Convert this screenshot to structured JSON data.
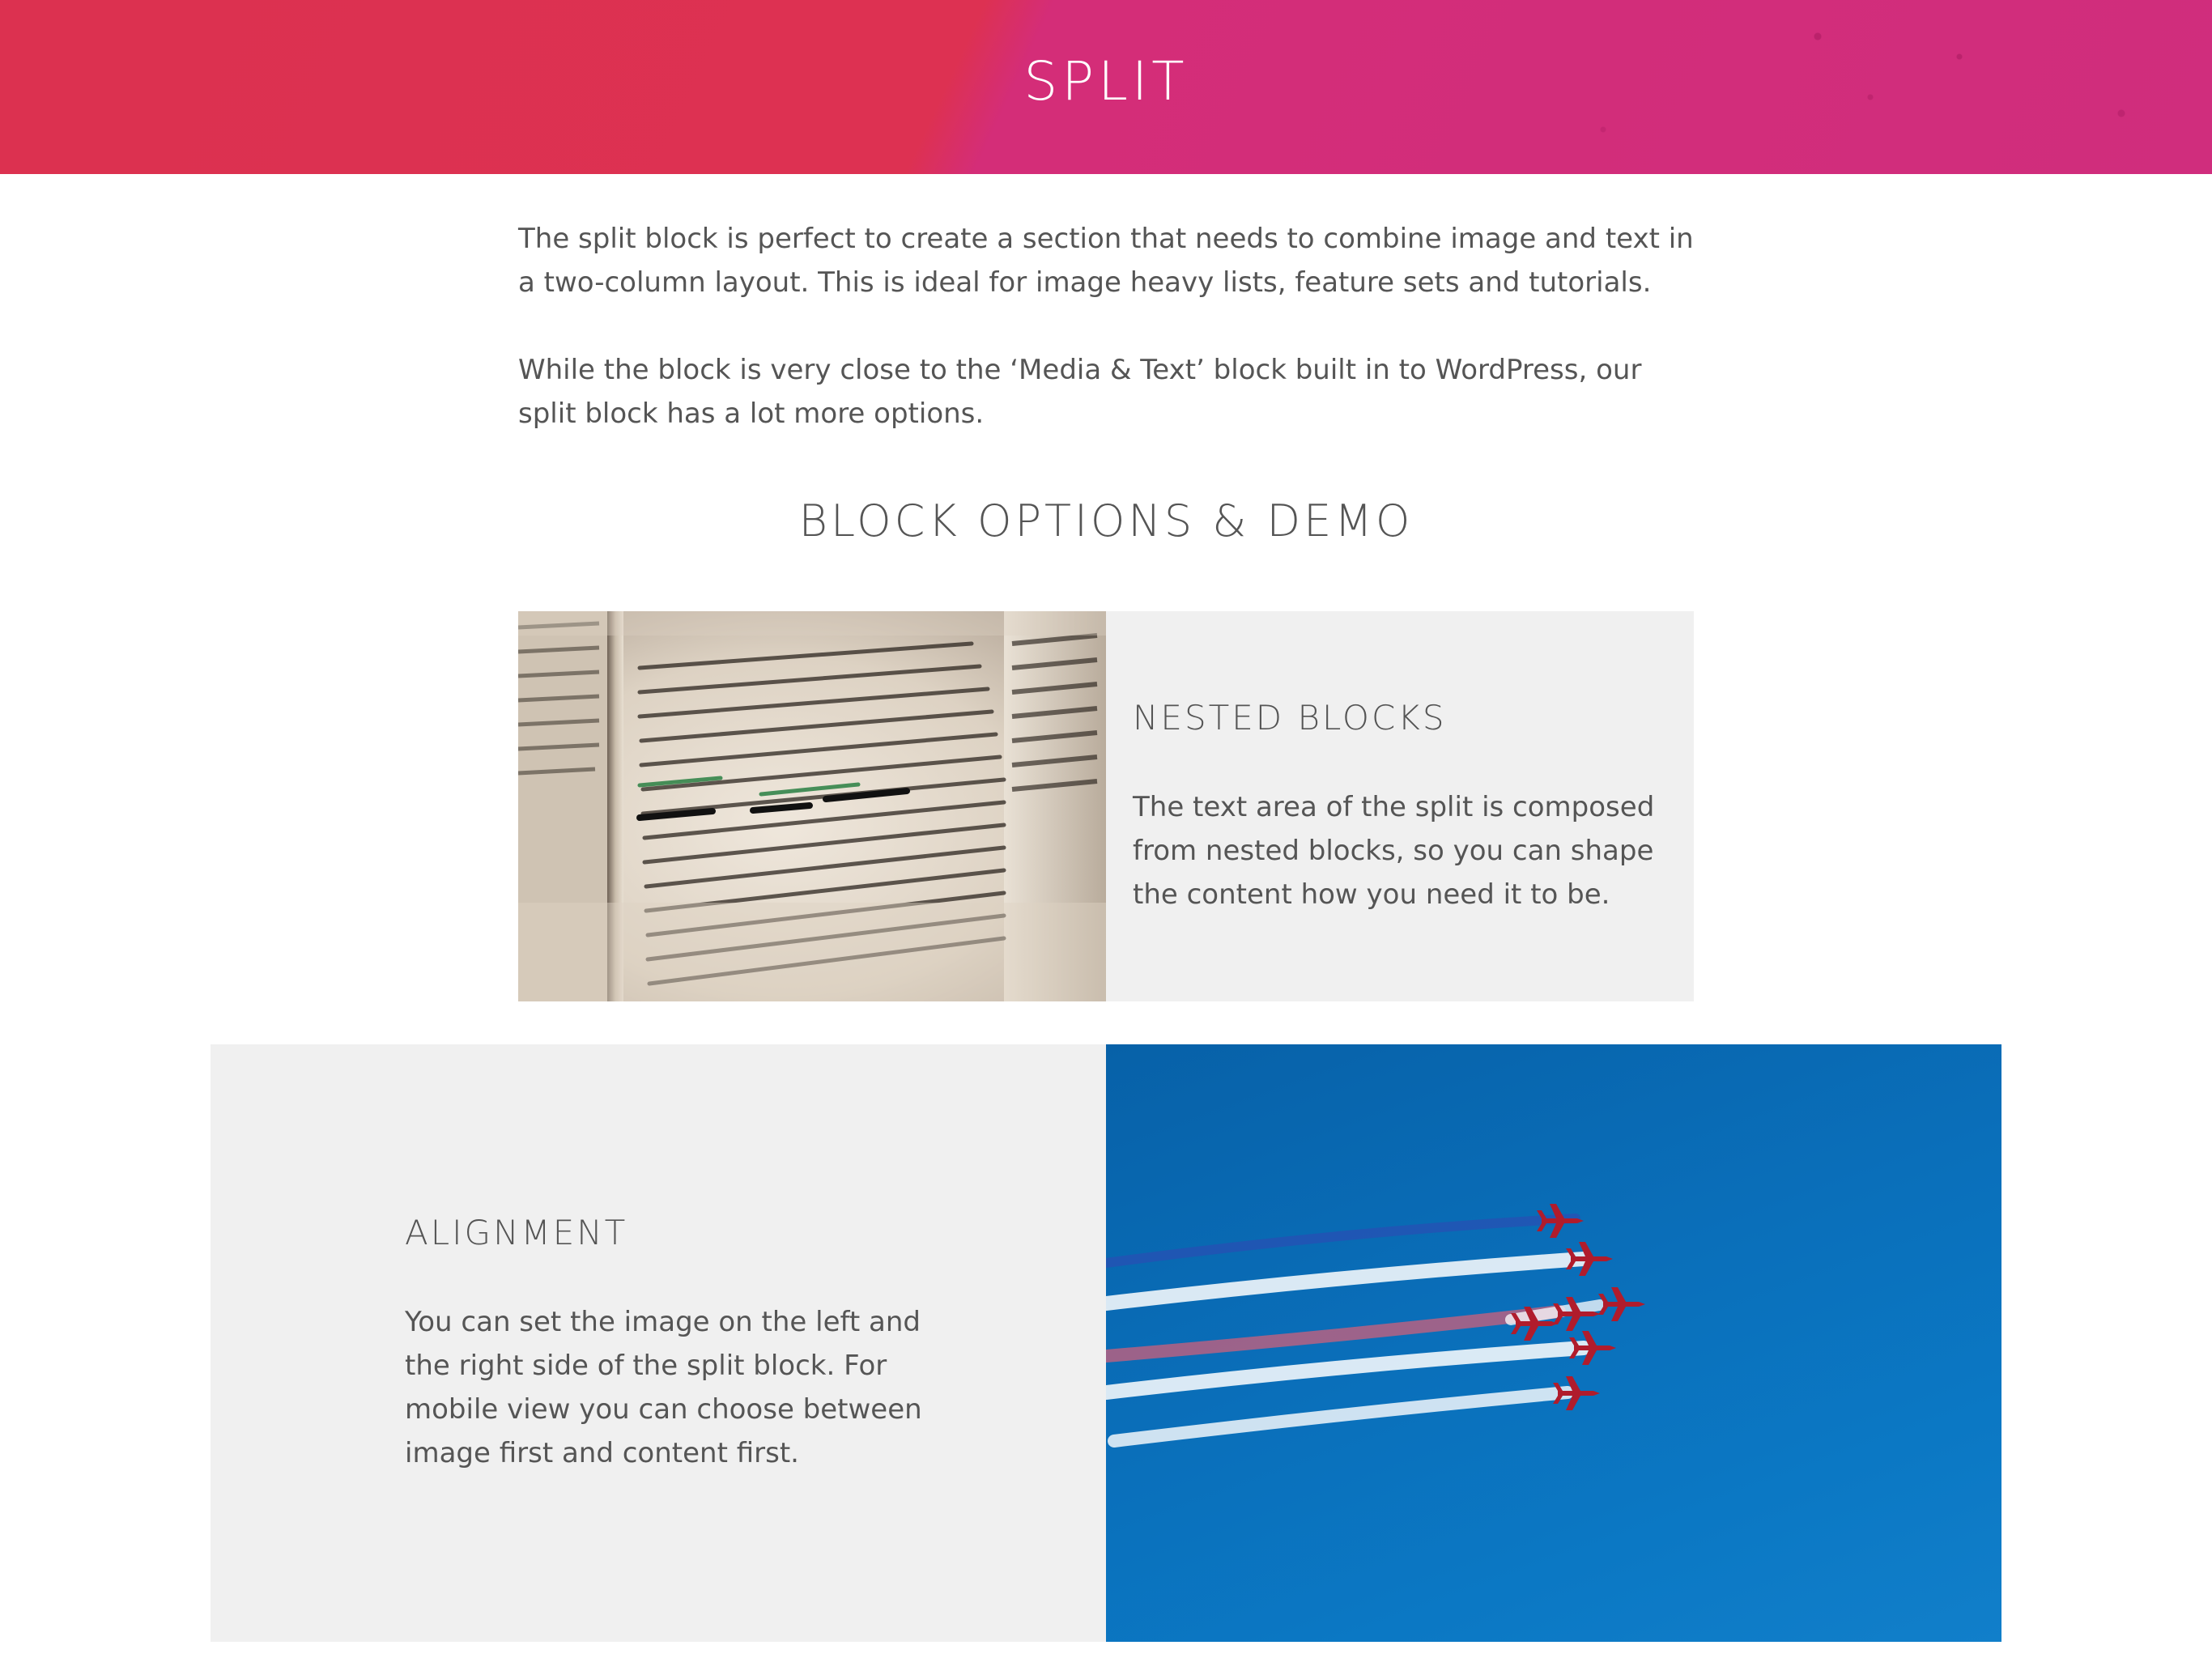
{
  "header": {
    "title": "SPLIT"
  },
  "intro": {
    "paragraphs": [
      "The split block is perfect to create a section that needs to combine image and text in a two-column layout. This is ideal for image heavy lists, feature sets and tutorials.",
      "While the block is very close to the ‘Media & Text’ block built in to WordPress, our split block has a lot more options."
    ]
  },
  "section": {
    "heading": "BLOCK OPTIONS & DEMO"
  },
  "split_blocks": [
    {
      "heading": "NESTED BLOCKS",
      "text": "The text area of the split is composed from nested blocks, so you can shape the content how you need it to be.",
      "image": "open-dictionary-photo",
      "image_side": "left"
    },
    {
      "heading": "ALIGNMENT",
      "text": "You can set the image on the left and the right side of the split block. For mobile view you can choose between image first and content first.",
      "image": "jets-formation-sky-photo",
      "image_side": "right"
    }
  ],
  "colors": {
    "banner_left": "#dc3150",
    "banner_right": "#d02d7d",
    "text": "#555555",
    "panel_bg": "#f0f0f0",
    "sky": "#0a6fba"
  }
}
